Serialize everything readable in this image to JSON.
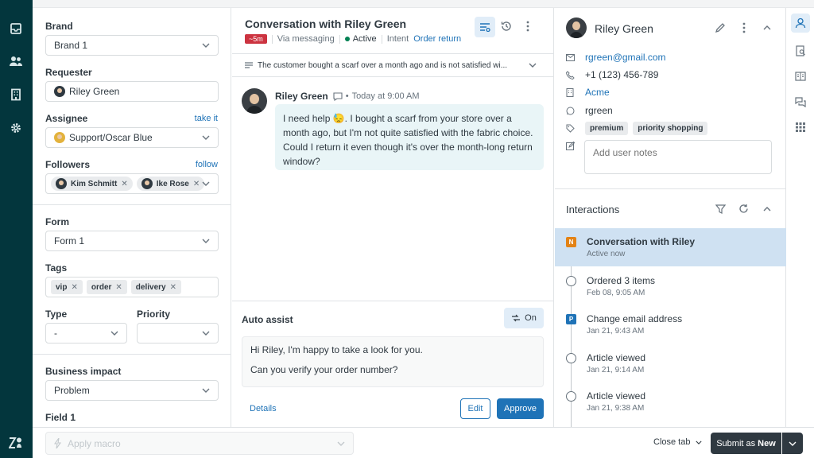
{
  "left_panel": {
    "brand": {
      "label": "Brand",
      "value": "Brand 1"
    },
    "requester": {
      "label": "Requester",
      "value": "Riley Green"
    },
    "assignee": {
      "label": "Assignee",
      "link": "take it",
      "value": "Support/Oscar Blue"
    },
    "followers": {
      "label": "Followers",
      "link": "follow",
      "items": [
        "Kim Schmitt",
        "Ike Rose"
      ]
    },
    "form": {
      "label": "Form",
      "value": "Form 1"
    },
    "tags": {
      "label": "Tags",
      "items": [
        "vip",
        "order",
        "delivery"
      ]
    },
    "type": {
      "label": "Type",
      "value": "-"
    },
    "priority": {
      "label": "Priority",
      "value": ""
    },
    "business_impact": {
      "label": "Business impact",
      "value": "Problem"
    },
    "field1": {
      "label": "Field 1"
    }
  },
  "conversation": {
    "title": "Conversation with Riley Green",
    "badge": "~5m",
    "channel": "Via messaging",
    "status": "Active",
    "intent_label": "Intent",
    "intent_value": "Order return",
    "summary": "The customer bought a scarf over a month ago and is not satisfied wi...",
    "message": {
      "author": "Riley Green",
      "time": "Today at 9:00 AM",
      "text": "I need help 😓. I bought a scarf from your store over a month ago, but I'm not quite satisfied with the fabric choice. Could I return it even though it's over the month-long return window?"
    }
  },
  "auto_assist": {
    "title": "Auto assist",
    "toggle_label": "On",
    "reply_line1": "Hi Riley, I'm happy to take a look for you.",
    "reply_line2": "Can you verify your order number?",
    "details_label": "Details",
    "edit_label": "Edit",
    "approve_label": "Approve"
  },
  "user_panel": {
    "name": "Riley Green",
    "email": "rgreen@gmail.com",
    "phone": "+1 (123) 456-789",
    "org": "Acme",
    "whatsapp": "rgreen",
    "tags": [
      "premium",
      "priority shopping"
    ],
    "notes_placeholder": "Add user notes"
  },
  "interactions": {
    "title": "Interactions",
    "items": [
      {
        "title": "Conversation with Riley",
        "sub": "Active now",
        "marker": "N",
        "marker_color": "#e38215"
      },
      {
        "title": "Ordered 3 items",
        "sub": "Feb 08, 9:05 AM",
        "marker": "",
        "marker_color": ""
      },
      {
        "title": "Change email address",
        "sub": "Jan 21, 9:43 AM",
        "marker": "P",
        "marker_color": "#1f73b7"
      },
      {
        "title": "Article viewed",
        "sub": "Jan 21, 9:14 AM",
        "marker": "",
        "marker_color": ""
      },
      {
        "title": "Article viewed",
        "sub": "Jan 21, 9:38 AM",
        "marker": "",
        "marker_color": ""
      }
    ]
  },
  "bottom": {
    "macro_placeholder": "Apply macro",
    "close_tab": "Close tab",
    "submit_prefix": "Submit as ",
    "submit_status": "New"
  },
  "colors": {
    "nav": "#03363d",
    "accent": "#1f73b7",
    "active_row": "#cfe1f2",
    "message_bubble": "#e9f5f7",
    "submit": "#2f3941"
  }
}
